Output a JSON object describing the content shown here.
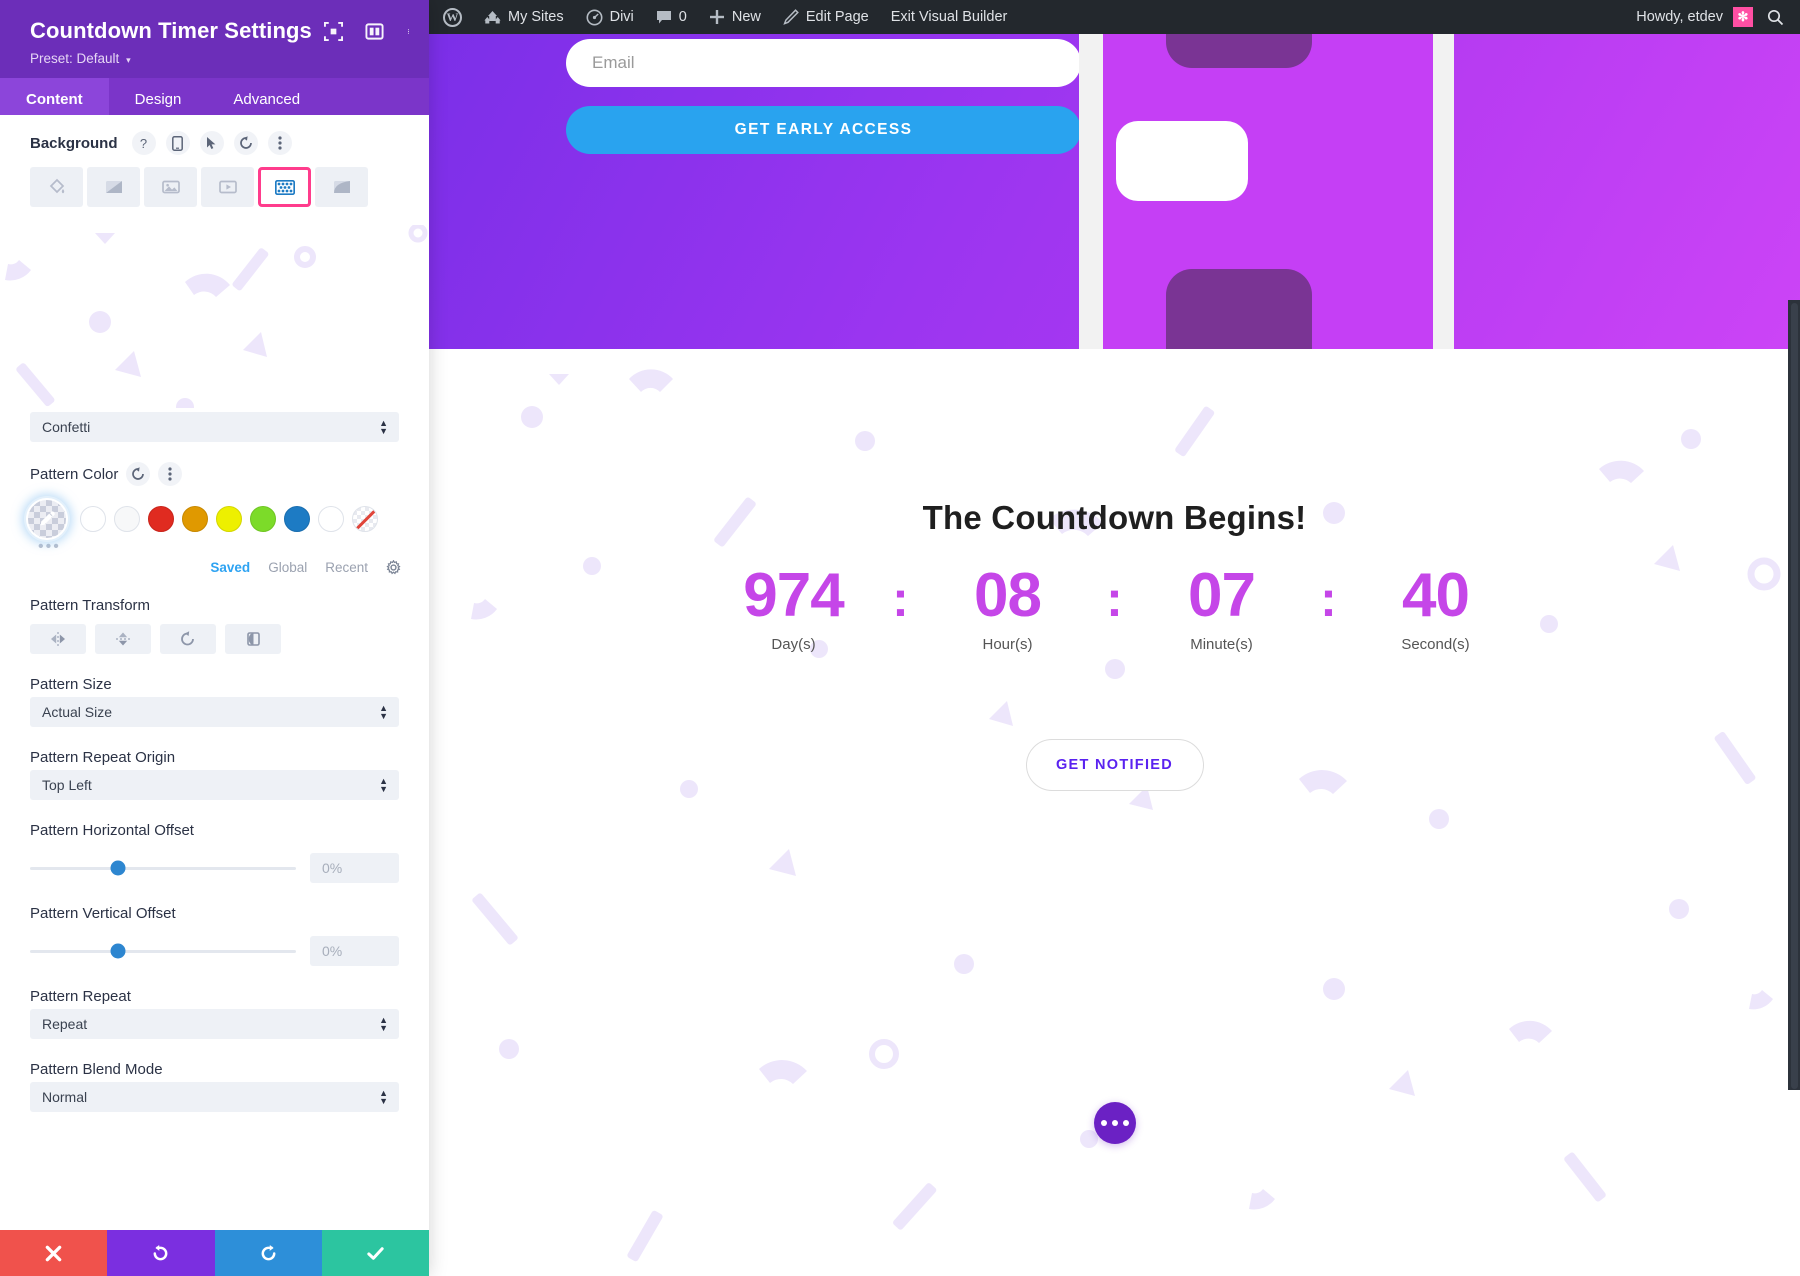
{
  "settings_panel": {
    "title": "Countdown Timer Settings",
    "preset": "Preset: Default",
    "header_icons": [
      "focus-frame-icon",
      "panel-layout-icon",
      "vertical-dots-icon"
    ],
    "tabs": [
      {
        "label": "Content",
        "active": true
      },
      {
        "label": "Design",
        "active": false
      },
      {
        "label": "Advanced",
        "active": false
      }
    ],
    "background": {
      "label": "Background",
      "inline_icons": [
        "help-icon",
        "responsive-icon",
        "hover-icon",
        "reset-icon",
        "options-dots-icon"
      ],
      "types": [
        {
          "name": "color-fill",
          "selected": false
        },
        {
          "name": "gradient",
          "selected": false
        },
        {
          "name": "image",
          "selected": false
        },
        {
          "name": "video",
          "selected": false
        },
        {
          "name": "pattern",
          "selected": true
        },
        {
          "name": "mask",
          "selected": false
        }
      ]
    },
    "pattern_select": {
      "value": "Confetti"
    },
    "pattern_color": {
      "label": "Pattern Color",
      "reset_icon": "reset-icon",
      "options_icon": "vertical-dots-icon",
      "swatches": [
        {
          "name": "eyedropper-picker",
          "color": "transparent"
        },
        {
          "name": "swatch-white-1",
          "color": "#ffffff"
        },
        {
          "name": "swatch-white-2",
          "color": "#fafafa"
        },
        {
          "name": "swatch-red",
          "color": "#e02b20"
        },
        {
          "name": "swatch-orange",
          "color": "#e09900"
        },
        {
          "name": "swatch-yellow",
          "color": "#edf000"
        },
        {
          "name": "swatch-green",
          "color": "#7cdb29"
        },
        {
          "name": "swatch-blue",
          "color": "#1d7bc4"
        },
        {
          "name": "swatch-white-3",
          "color": "#ffffff"
        },
        {
          "name": "swatch-none",
          "color": "none"
        }
      ],
      "more_dots": "•••",
      "tabs": [
        {
          "label": "Saved",
          "active": true
        },
        {
          "label": "Global",
          "active": false
        },
        {
          "label": "Recent",
          "active": false
        }
      ],
      "gear_icon": "gear-icon"
    },
    "pattern_transform": {
      "label": "Pattern Transform",
      "buttons": [
        "flip-horizontal-icon",
        "flip-vertical-icon",
        "rotate-icon",
        "invert-icon"
      ]
    },
    "pattern_size": {
      "label": "Pattern Size",
      "value": "Actual Size"
    },
    "pattern_repeat_origin": {
      "label": "Pattern Repeat Origin",
      "value": "Top Left"
    },
    "pattern_horizontal_offset": {
      "label": "Pattern Horizontal Offset",
      "value": "0%",
      "knob_pct": 33
    },
    "pattern_vertical_offset": {
      "label": "Pattern Vertical Offset",
      "value": "0%",
      "knob_pct": 33
    },
    "pattern_repeat": {
      "label": "Pattern Repeat",
      "value": "Repeat"
    },
    "pattern_blend_mode": {
      "label": "Pattern Blend Mode",
      "value": "Normal"
    },
    "actions": [
      {
        "name": "cancel-button",
        "icon": "close-icon",
        "color": "#F0524C"
      },
      {
        "name": "undo-button",
        "icon": "undo-icon",
        "color": "#7B2FE0"
      },
      {
        "name": "redo-button",
        "icon": "redo-icon",
        "color": "#2D8FD9"
      },
      {
        "name": "save-button",
        "icon": "check-icon",
        "color": "#2CC5A0"
      }
    ]
  },
  "admin_bar": {
    "logo": "wordpress-logo-icon",
    "items": [
      {
        "label": "My Sites",
        "icon": "sites-icon"
      },
      {
        "label": "Divi",
        "icon": "divi-icon"
      },
      {
        "label": "0",
        "icon": "comment-icon"
      },
      {
        "label": "New",
        "icon": "plus-icon"
      },
      {
        "label": "Edit Page",
        "icon": "pencil-icon"
      },
      {
        "label": "Exit Visual Builder",
        "icon": ""
      }
    ],
    "greeting": "Howdy, etdev",
    "avatar_glyph": "✻",
    "search_icon": "search-icon"
  },
  "page": {
    "hero": {
      "email_placeholder": "Email",
      "cta_label": "GET EARLY ACCESS"
    },
    "countdown": {
      "title": "The Countdown Begins!",
      "units": [
        {
          "value": "974",
          "label": "Day(s)"
        },
        {
          "value": "08",
          "label": "Hour(s)"
        },
        {
          "value": "07",
          "label": "Minute(s)"
        },
        {
          "value": "40",
          "label": "Second(s)"
        }
      ],
      "separator": ":",
      "notify_label": "GET NOTIFIED"
    },
    "fab": {
      "name": "divi-menu-fab",
      "icon": "three-dots-icon"
    }
  },
  "colors": {
    "panel_header": "#6C2EB9",
    "tab_bar": "#7B35C9",
    "tab_active": "#8C45DA",
    "selected_outline": "#FF3C8C",
    "countdown_accent": "#C546E8",
    "notify_text": "#5A22F0",
    "cta_blue": "#29A3EF",
    "confetti": "#ECE4FB"
  }
}
